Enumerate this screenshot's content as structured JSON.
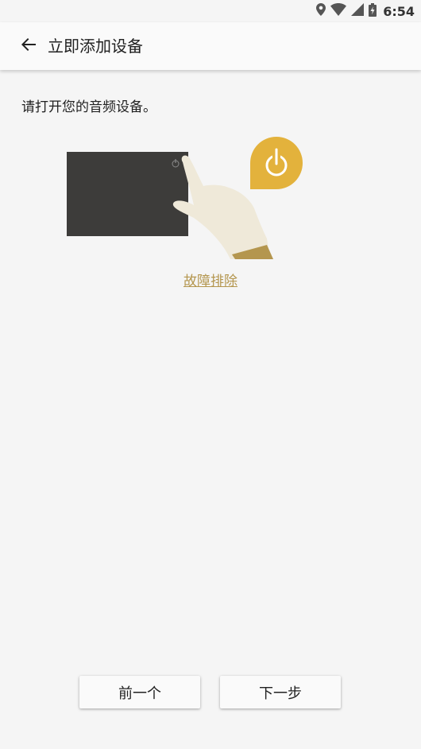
{
  "status_bar": {
    "time": "6:54",
    "icons": [
      "location-icon",
      "wifi-icon",
      "cell-signal-icon",
      "battery-charging-icon"
    ]
  },
  "app_bar": {
    "title": "立即添加设备",
    "back_icon": "arrow-back-icon"
  },
  "content": {
    "instruction": "请打开您的音频设备。",
    "troubleshoot_link": "故障排除"
  },
  "buttons": {
    "prev_label": "前一个",
    "next_label": "下一步"
  },
  "colors": {
    "background": "#f5f5f5",
    "accent": "#b4964e",
    "power_badge": "#e3b23c",
    "device": "#3d3c3a",
    "hand": "#efe9d9"
  }
}
